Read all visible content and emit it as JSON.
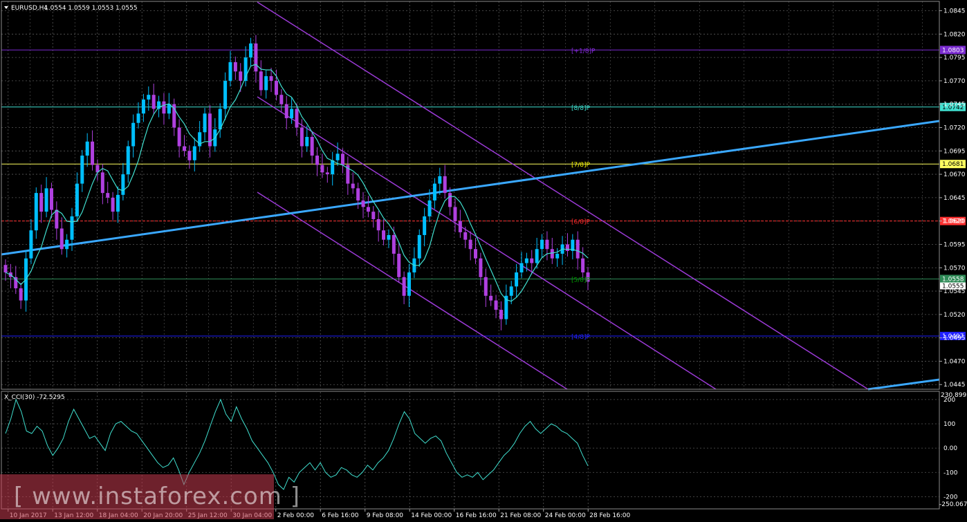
{
  "header": {
    "symbol_label": "EURUSD,H4",
    "ohlc": "1.0554 1.0559 1.0553 1.0555"
  },
  "indicator": {
    "label": "X_CCI(30) -72.5295",
    "top_value": "230.8992",
    "bottom_value": "-250.067"
  },
  "watermark": {
    "text": "[ www.instaforex.com ]"
  },
  "colors": {
    "background": "#000000",
    "grid": "#5a5a5a",
    "bull_candle": "#00bfff",
    "bear_candle": "#b040e0",
    "ma_line": "#40e0d0",
    "trend_line": "#3aa8ff",
    "channel": "#9b3ad6",
    "cci_line": "#40e0d0"
  },
  "chart_data": {
    "type": "candlestick",
    "symbol": "EURUSD",
    "timeframe": "H4",
    "y_axis_ticks": [
      "1.0845",
      "1.0820",
      "1.0795",
      "1.0770",
      "1.0745",
      "1.0720",
      "1.0695",
      "1.0670",
      "1.0645",
      "1.0620",
      "1.0595",
      "1.0570",
      "1.0545",
      "1.0520",
      "1.0495",
      "1.0470",
      "1.0445"
    ],
    "y_range": [
      1.044,
      1.0855
    ],
    "x_axis_labels": [
      "10 Jan 2017",
      "13 Jan 12:00",
      "18 Jan 04:00",
      "20 Jan 20:00",
      "25 Jan 12:00",
      "30 Jan 04:00",
      "2 Feb 00:00",
      "6 Feb 16:00",
      "9 Feb 08:00",
      "14 Feb 00:00",
      "16 Feb 16:00",
      "21 Feb 08:00",
      "24 Feb 00:00",
      "28 Feb 16:00"
    ],
    "murrey_levels": [
      {
        "label": "[+1/8]P",
        "price": "1.0803",
        "value": 1.0803,
        "color": "#8a2be2",
        "line": "#7a2bd0"
      },
      {
        "label": "[8/8]P",
        "price": "1.0742",
        "value": 1.0742,
        "color": "#40e0d0",
        "line": "#40e0d0"
      },
      {
        "label": "[7/8]P",
        "price": "1.0681",
        "value": 1.0681,
        "color": "#ffff00",
        "line": "#ffff60"
      },
      {
        "label": "[6/8]P",
        "price": "1.0620",
        "value": 1.062,
        "color": "#ff2a2a",
        "line": "#ff3030"
      },
      {
        "label": "[5/8]P",
        "price": "1.0558",
        "value": 1.0558,
        "color": "#00aa00",
        "line": "#2e8b57"
      },
      {
        "label": "[4/8]P",
        "price": "1.0497",
        "value": 1.0497,
        "color": "#2020ff",
        "line": "#2020ff"
      }
    ],
    "current_price": "1.0555",
    "current_value": 1.0555,
    "closes": [
      1.0565,
      1.056,
      1.0548,
      1.0535,
      1.058,
      1.061,
      1.065,
      1.063,
      1.0655,
      1.0632,
      1.0612,
      1.059,
      1.06,
      1.0625,
      1.066,
      1.069,
      1.0705,
      1.068,
      1.0672,
      1.065,
      1.0645,
      1.063,
      1.0648,
      1.067,
      1.07,
      1.0725,
      1.0735,
      1.075,
      1.0755,
      1.074,
      1.0748,
      1.0735,
      1.0745,
      1.072,
      1.07,
      1.0695,
      1.0685,
      1.07,
      1.0715,
      1.0735,
      1.07,
      1.0718,
      1.074,
      1.077,
      1.079,
      1.078,
      1.077,
      1.0795,
      1.081,
      1.078,
      1.076,
      1.0775,
      1.077,
      1.0755,
      1.0745,
      1.073,
      1.074,
      1.072,
      1.07,
      1.071,
      1.069,
      1.068,
      1.0672,
      1.067,
      1.0685,
      1.0692,
      1.068,
      1.066,
      1.0655,
      1.0642,
      1.0635,
      1.063,
      1.0622,
      1.061,
      1.06,
      1.0605,
      1.0585,
      1.056,
      1.054,
      1.0565,
      1.058,
      1.0605,
      1.0625,
      1.0642,
      1.066,
      1.0668,
      1.065,
      1.0635,
      1.062,
      1.0608,
      1.06,
      1.059,
      1.058,
      1.056,
      1.054,
      1.0535,
      1.0525,
      1.0515,
      1.054,
      1.055,
      1.0565,
      1.0575,
      1.058,
      1.0575,
      1.059,
      1.06,
      1.059,
      1.058,
      1.0585,
      1.0595,
      1.0588,
      1.06,
      1.058,
      1.0565,
      1.0555
    ],
    "cci_axis_ticks": [
      "200",
      "100",
      "0.00",
      "-100",
      "-200"
    ],
    "cci_range": [
      -250.067,
      230.8992
    ],
    "cci_values": [
      60,
      120,
      200,
      150,
      70,
      60,
      90,
      70,
      10,
      -30,
      0,
      40,
      110,
      160,
      120,
      80,
      40,
      50,
      20,
      -10,
      60,
      100,
      110,
      90,
      70,
      60,
      30,
      0,
      -30,
      -60,
      -80,
      -70,
      -40,
      -90,
      -150,
      -100,
      -60,
      -20,
      30,
      90,
      150,
      200,
      140,
      110,
      170,
      120,
      80,
      30,
      0,
      -30,
      -60,
      -100,
      -150,
      -170,
      -120,
      -140,
      -100,
      -80,
      -60,
      -90,
      -60,
      -100,
      -120,
      -110,
      -80,
      -90,
      -110,
      -120,
      -100,
      -70,
      -90,
      -60,
      -40,
      -10,
      40,
      100,
      150,
      120,
      60,
      40,
      20,
      40,
      50,
      30,
      -20,
      -60,
      -100,
      -120,
      -110,
      -120,
      -100,
      -130,
      -110,
      -90,
      -60,
      -30,
      -10,
      20,
      60,
      90,
      110,
      80,
      60,
      80,
      100,
      90,
      70,
      60,
      40,
      20,
      -30,
      -73
    ]
  }
}
